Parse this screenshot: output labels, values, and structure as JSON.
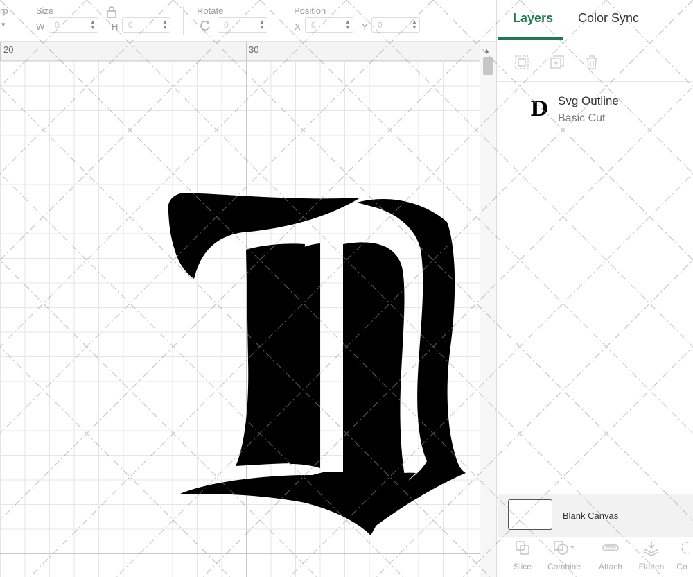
{
  "toolbar": {
    "partial_label": "rp",
    "size_label": "Size",
    "width_axis": "W",
    "height_axis": "H",
    "rotate_label": "Rotate",
    "position_label": "Position",
    "x_axis": "X",
    "y_axis": "Y",
    "width_value": "0",
    "height_value": "0",
    "rotate_value": "0",
    "x_value": "0",
    "y_value": "0",
    "lock_icon": "lock-icon",
    "rotate_icon": "rotate-icon"
  },
  "ruler": {
    "marks": [
      "20",
      "30"
    ]
  },
  "design": {
    "letter_icon": "old-english-d-shape"
  },
  "panel": {
    "tabs": [
      {
        "label": "Layers",
        "active": true
      },
      {
        "label": "Color Sync",
        "active": false
      }
    ],
    "active_color": "#1f7a4d",
    "layer_tools": [
      "group-icon",
      "duplicate-icon",
      "delete-icon"
    ],
    "layers": [
      {
        "thumb": "D",
        "name": "Svg Outline",
        "operation": "Basic Cut"
      }
    ],
    "canvas_label": "Blank Canvas",
    "bottom_tools": [
      {
        "label": "Slice",
        "icon": "slice-icon"
      },
      {
        "label": "Combine",
        "icon": "combine-icon"
      },
      {
        "label": "Attach",
        "icon": "attach-icon"
      },
      {
        "label": "Flatten",
        "icon": "flatten-icon"
      },
      {
        "label": "Co",
        "icon": "contour-icon"
      }
    ]
  }
}
